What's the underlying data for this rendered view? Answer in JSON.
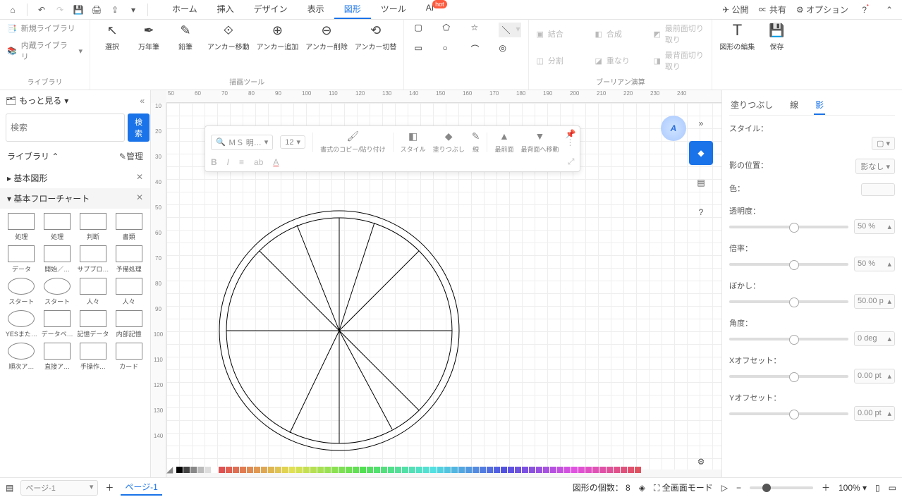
{
  "titlebar": {
    "menus": [
      "ホーム",
      "挿入",
      "デザイン",
      "表示",
      "図形",
      "ツール",
      "AI"
    ],
    "active_menu": 4,
    "hot": "hot",
    "right": {
      "publish": "公開",
      "share": "共有",
      "options": "オプション"
    }
  },
  "ribbon": {
    "library": {
      "new": "新規ライブラリ",
      "builtin": "内蔵ライブラリ",
      "label": "ライブラリ"
    },
    "draw": {
      "select": "選択",
      "pen": "万年筆",
      "pencil": "鉛筆",
      "anchor_move": "アンカー移動",
      "anchor_add": "アンカー追加",
      "anchor_del": "アンカー削除",
      "anchor_toggle": "アンカー切替",
      "label": "描画ツール"
    },
    "bool": {
      "merge": "結合",
      "compose": "合成",
      "clipfront": "最前面切り取り",
      "split": "分割",
      "overlap": "重なり",
      "clipback": "最背面切り取り",
      "label": "ブーリアン演算"
    },
    "edit": {
      "edit": "図形の編集",
      "save": "保存"
    }
  },
  "left": {
    "more": "もっと見る",
    "search_placeholder": "検索",
    "search_btn": "検索",
    "lib": "ライブラリ",
    "manage": "管理",
    "cat1": "基本図形",
    "cat2": "基本フローチャート",
    "shapes": [
      "処理",
      "処理",
      "判断",
      "書類",
      "データ",
      "開始／…",
      "サブプロ…",
      "予備処理",
      "スタート",
      "スタート",
      "人々",
      "人々",
      "YESまた…",
      "データベ…",
      "記憶データ",
      "内部記憶",
      "順次ア…",
      "直接ア…",
      "手操作…",
      "カード"
    ]
  },
  "float": {
    "font": "ＭＳ 明…",
    "size": "12",
    "copyfmt": "書式のコピー/貼り付け",
    "style": "スタイル",
    "fill": "塗りつぶし",
    "line": "線",
    "front": "最前面",
    "back": "最背面へ移動"
  },
  "right": {
    "tabs": [
      "塗りつぶし",
      "線",
      "影"
    ],
    "active_tab": 2,
    "style": "スタイル：",
    "pos": "影の位置：",
    "pos_val": "影なし",
    "color": "色：",
    "opacity": "透明度：",
    "opacity_val": "50 %",
    "scale": "倍率：",
    "scale_val": "50 %",
    "blur": "ぼかし：",
    "blur_val": "50.00 p",
    "angle": "角度：",
    "angle_val": "0 deg",
    "xoff": "Xオフセット：",
    "xoff_val": "0.00 pt",
    "yoff": "Yオフセット：",
    "yoff_val": "0.00 pt"
  },
  "status": {
    "page_sel": "ページ-1",
    "page_tab": "ページ-1",
    "shape_count_label": "図形の個数：",
    "shape_count": "8",
    "fullscreen": "全画面モード",
    "zoom": "100%"
  },
  "rulers": {
    "h": [
      "50",
      "60",
      "70",
      "80",
      "90",
      "100",
      "110",
      "120",
      "130",
      "140",
      "150",
      "160",
      "170",
      "180",
      "190",
      "200",
      "210",
      "220",
      "230",
      "240"
    ],
    "v": [
      "10",
      "20",
      "30",
      "40",
      "50",
      "60",
      "70",
      "80",
      "90",
      "100",
      "110",
      "120",
      "130",
      "140"
    ]
  }
}
